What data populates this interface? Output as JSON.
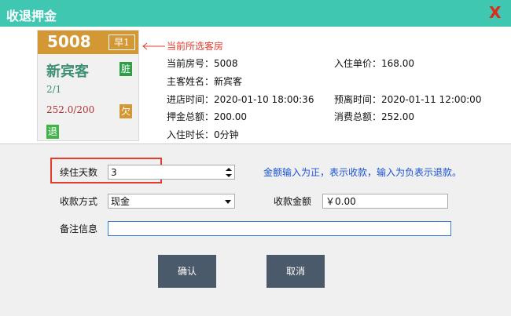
{
  "window": {
    "title": "收退押金",
    "close_label": "X"
  },
  "room_card": {
    "room_number": "5008",
    "time_badge": "早1",
    "guest_name": "新宾客",
    "dirty_badge": "脏",
    "guest_count": "2/1",
    "balance": "252.0/200",
    "owe_badge": "欠",
    "checkout_badge": "退",
    "colors": {
      "header": "#d39733",
      "guest": "#3d8f75",
      "balance": "#b03030",
      "dirty": "#2e9e4a",
      "checkout": "#42b348"
    }
  },
  "annotation": "当前所选客房",
  "info": {
    "room_no": "当前房号：5008",
    "unit_price": "入住单价：168.00",
    "guest": "主客姓名：新宾客",
    "checkin_time": "进店时间：2020-01-10 18:00:36",
    "expected_leave": "预离时间：2020-01-11 12:00:00",
    "deposit_total": "押金总额：200.00",
    "consume_total": "消费总额：252.00",
    "stay_duration": "入住时长：0分钟"
  },
  "form": {
    "extend_days_label": "续住天数",
    "extend_days_value": "3",
    "hint": "金额输入为正，表示收款，输入为负表示退款。",
    "payment_method_label": "收款方式",
    "payment_method_value": "现金",
    "amount_label": "收款金额",
    "amount_value": "￥0.00",
    "remark_label": "备注信息",
    "remark_value": ""
  },
  "buttons": {
    "confirm": "确认",
    "cancel": "取消"
  },
  "colors": {
    "titlebar": "#3fc7b2",
    "close": "#e02a17",
    "hint": "#1a52d4",
    "highlight": "#e53b2f",
    "button": "#4b5a6a"
  }
}
